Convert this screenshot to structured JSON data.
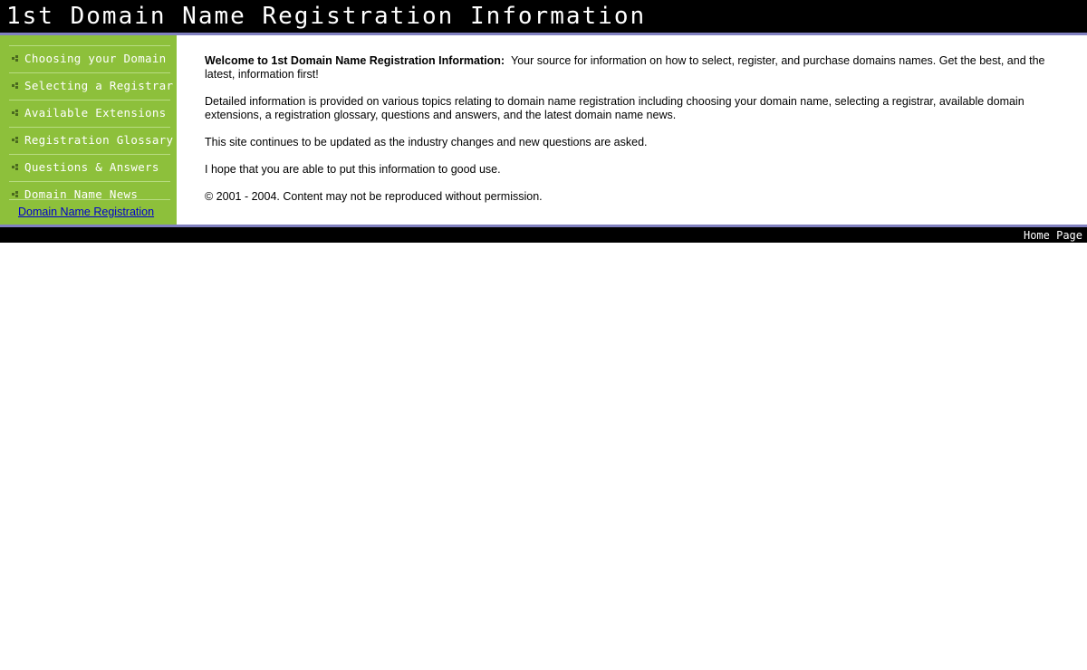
{
  "header": {
    "title": "1st Domain Name Registration Information"
  },
  "sidebar": {
    "items": [
      {
        "label": "Choosing your Domain",
        "icon": "bullet-icon"
      },
      {
        "label": "Selecting a Registrar",
        "icon": "bullet-icon"
      },
      {
        "label": "Available Extensions",
        "icon": "bullet-icon"
      },
      {
        "label": "Registration Glossary",
        "icon": "bullet-icon"
      },
      {
        "label": "Questions & Answers",
        "icon": "bullet-icon"
      },
      {
        "label": "Domain Name News",
        "icon": "bullet-icon"
      }
    ],
    "link_label": "Domain Name Registration"
  },
  "content": {
    "intro_bold": "Welcome to 1st Domain Name Registration Information:",
    "intro_text": "Your source for information on how to select, register, and purchase domains names.  Get the best, and the latest, information first!",
    "paragraph_2": "Detailed information is provided on various topics relating to domain name registration including choosing your domain name, selecting a registrar, available domain extensions, a registration glossary, questions and answers, and the latest domain name news.",
    "paragraph_3": "This site continues to be updated as the industry changes and new questions are asked.",
    "paragraph_4": "I hope that you are able to put this information to good use.",
    "copyright": "© 2001 - 2004.  Content may not be reproduced without permission."
  },
  "footer": {
    "home_label": "Home Page"
  },
  "colors": {
    "sidebar_green": "#8dc03b",
    "header_black": "#000000",
    "accent_border": "#8080c0",
    "link_blue": "#0000cc"
  }
}
